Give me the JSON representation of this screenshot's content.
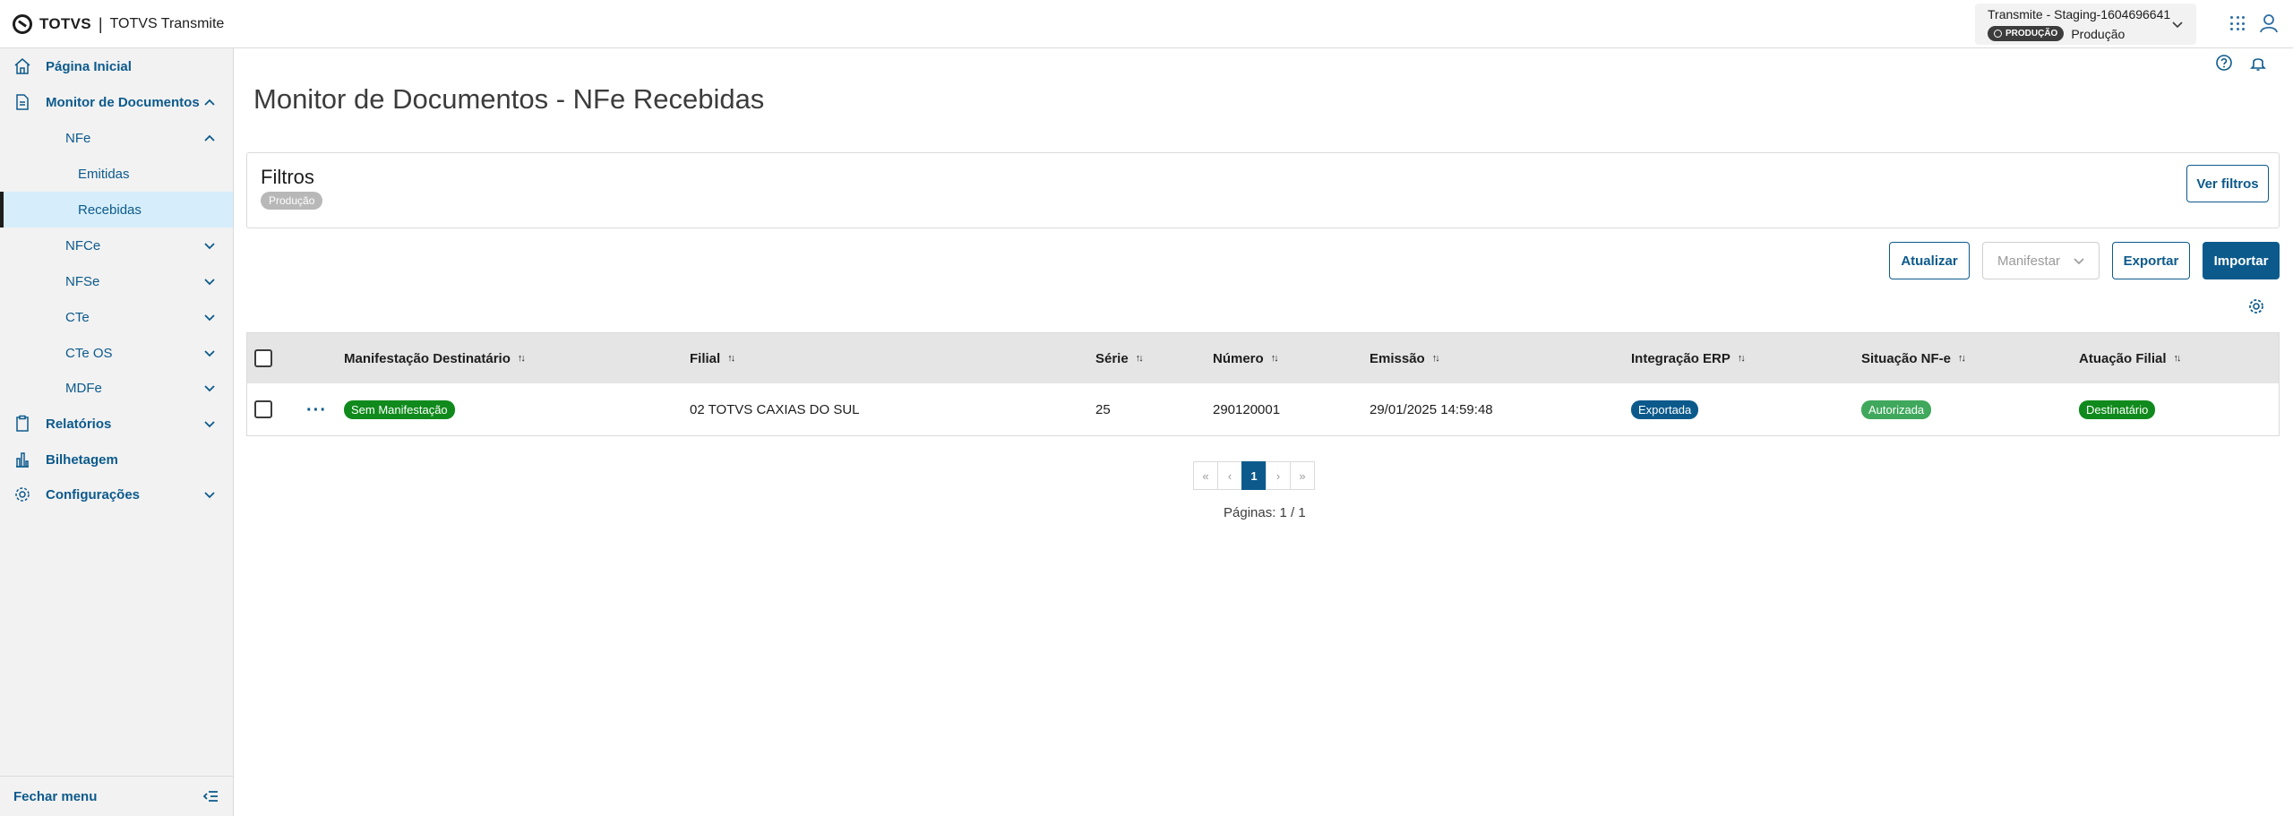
{
  "header": {
    "brand": "TOTVS",
    "separator": "|",
    "app_name": "TOTVS Transmite",
    "environment": {
      "title": "Transmite - Staging-1604696641...",
      "badge": "PRODUÇÃO",
      "subtitle": "Produção"
    }
  },
  "sidebar": {
    "items": [
      {
        "label": "Página Inicial"
      },
      {
        "label": "Monitor de Documentos"
      },
      {
        "label": "NFe"
      },
      {
        "label": "Emitidas"
      },
      {
        "label": "Recebidas"
      },
      {
        "label": "NFCe"
      },
      {
        "label": "NFSe"
      },
      {
        "label": "CTe"
      },
      {
        "label": "CTe OS"
      },
      {
        "label": "MDFe"
      },
      {
        "label": "Relatórios"
      },
      {
        "label": "Bilhetagem"
      },
      {
        "label": "Configurações"
      }
    ],
    "footer_label": "Fechar menu"
  },
  "page": {
    "title": "Monitor de Documentos - NFe Recebidas"
  },
  "filters": {
    "title": "Filtros",
    "chip": "Produção",
    "view_button": "Ver filtros"
  },
  "actions": {
    "refresh": "Atualizar",
    "manifest": "Manifestar",
    "export": "Exportar",
    "import": "Importar"
  },
  "table": {
    "columns": [
      "Manifestação Destinatário",
      "Filial",
      "Série",
      "Número",
      "Emissão",
      "Integração ERP",
      "Situação NF-e",
      "Atuação Filial"
    ],
    "rows": [
      {
        "manifestacao": "Sem Manifestação",
        "filial": "02 TOTVS CAXIAS DO SUL",
        "serie": "25",
        "numero": "290120001",
        "emissao": "29/01/2025 14:59:48",
        "integracao": "Exportada",
        "situacao": "Autorizada",
        "atuacao": "Destinatário"
      }
    ]
  },
  "pagination": {
    "first": "«",
    "prev": "‹",
    "current": "1",
    "next": "›",
    "last": "»",
    "pages_text": "Páginas: 1 / 1"
  },
  "colors": {
    "primary": "#0c5a8c",
    "badge_green": "#108a1c",
    "badge_blue": "#0c5a8c",
    "badge_light_green": "#3fa85c",
    "active_nav": "#d6eefb"
  },
  "icons": [
    "totvs-logo-icon",
    "chevron-down-icon",
    "apps-grid-icon",
    "user-icon",
    "home-icon",
    "document-icon",
    "chevron-up-icon",
    "clipboard-icon",
    "chart-bars-icon",
    "gear-icon",
    "collapse-menu-icon",
    "help-icon",
    "bell-icon",
    "more-horizontal-icon",
    "sort-icon"
  ]
}
